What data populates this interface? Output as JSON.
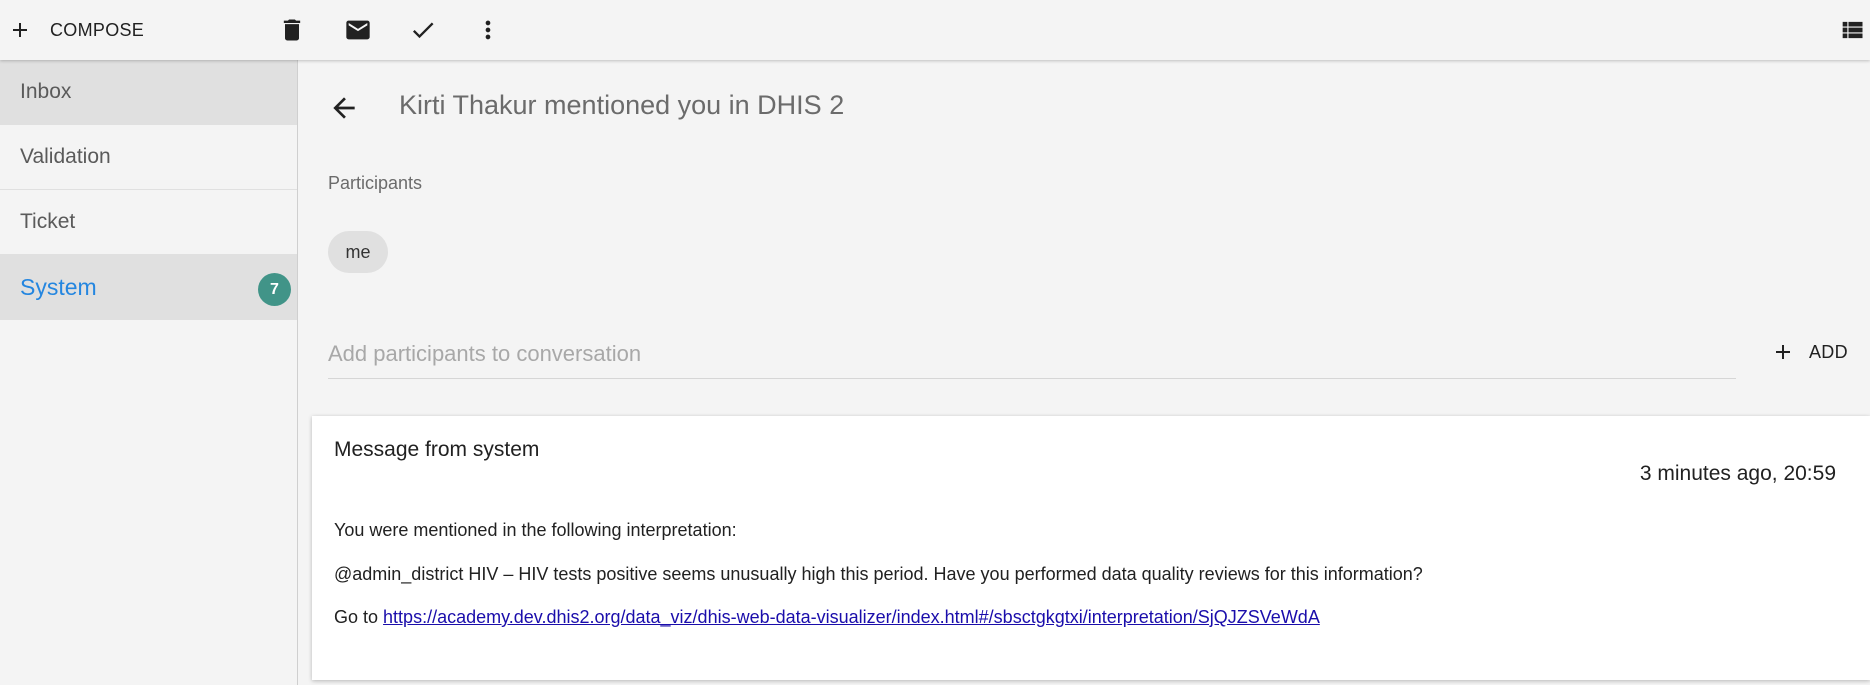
{
  "toolbar": {
    "compose_label": "COMPOSE",
    "icons": [
      "plus-icon",
      "trash-icon",
      "mail-icon",
      "check-icon",
      "more-vert-icon",
      "list-view-icon"
    ]
  },
  "sidebar": {
    "items": [
      {
        "label": "Inbox",
        "state": "selected"
      },
      {
        "label": "Validation"
      },
      {
        "label": "Ticket"
      },
      {
        "label": "System",
        "state": "active",
        "badge": "7"
      }
    ]
  },
  "conversation": {
    "subject": "Kirti Thakur mentioned you in DHIS 2",
    "participants_label": "Participants",
    "participants": [
      "me"
    ],
    "add_placeholder": "Add participants to conversation",
    "add_label": "ADD"
  },
  "message": {
    "sender": "Message from system",
    "timestamp": "3 minutes ago, 20:59",
    "line1": "You were mentioned in the following interpretation:",
    "line2": "@admin_district HIV – HIV tests positive seems unusually high this period. Have you performed data quality reviews for this information?",
    "goto_prefix": "Go to",
    "link": "https://academy.dev.dhis2.org/data_viz/dhis-web-data-visualizer/index.html#/sbsctgkgtxi/interpretation/SjQJZSVeWdA"
  },
  "colors": {
    "accent": "#2486e0",
    "badge": "#419488",
    "link": "#1a0dab",
    "background": "#f4f4f4"
  }
}
